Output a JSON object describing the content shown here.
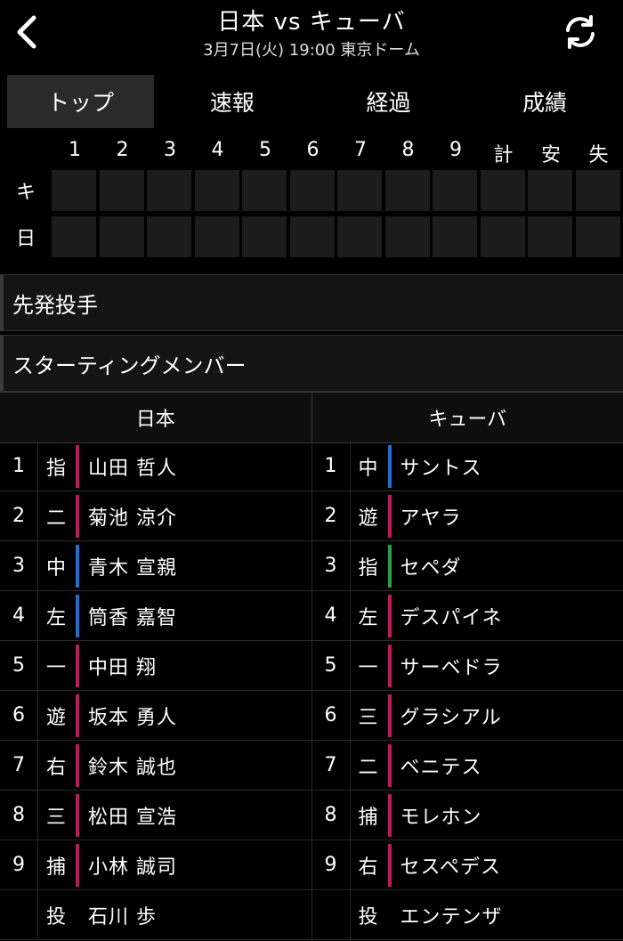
{
  "header": {
    "title": "日本 vs キューバ",
    "subtitle": "3月7日(火) 19:00 東京ドーム"
  },
  "tabs": [
    {
      "label": "トップ",
      "active": true
    },
    {
      "label": "速報",
      "active": false
    },
    {
      "label": "経過",
      "active": false
    },
    {
      "label": "成績",
      "active": false
    }
  ],
  "scoreboard": {
    "columns": [
      "1",
      "2",
      "3",
      "4",
      "5",
      "6",
      "7",
      "8",
      "9",
      "計",
      "安",
      "失"
    ],
    "teams": [
      "キ",
      "日"
    ]
  },
  "sections": {
    "starting_pitcher": "先発投手",
    "starting_members": "スターティングメンバー"
  },
  "lineup": {
    "home_label": "日本",
    "away_label": "キューバ",
    "colors": {
      "pink": "#c2185b",
      "blue": "#1e6fd9",
      "green": "#2e9e3e"
    },
    "japan": [
      {
        "order": "1",
        "pos": "指",
        "name": "山田 哲人",
        "bar": "pink"
      },
      {
        "order": "2",
        "pos": "二",
        "name": "菊池 涼介",
        "bar": "pink"
      },
      {
        "order": "3",
        "pos": "中",
        "name": "青木 宣親",
        "bar": "blue"
      },
      {
        "order": "4",
        "pos": "左",
        "name": "筒香 嘉智",
        "bar": "blue"
      },
      {
        "order": "5",
        "pos": "一",
        "name": "中田 翔",
        "bar": "pink"
      },
      {
        "order": "6",
        "pos": "遊",
        "name": "坂本 勇人",
        "bar": "pink"
      },
      {
        "order": "7",
        "pos": "右",
        "name": "鈴木 誠也",
        "bar": "pink"
      },
      {
        "order": "8",
        "pos": "三",
        "name": "松田 宣浩",
        "bar": "pink"
      },
      {
        "order": "9",
        "pos": "捕",
        "name": "小林 誠司",
        "bar": "pink"
      },
      {
        "order": "",
        "pos": "投",
        "name": "石川 歩",
        "bar": "none"
      }
    ],
    "cuba": [
      {
        "order": "1",
        "pos": "中",
        "name": "サントス",
        "bar": "blue"
      },
      {
        "order": "2",
        "pos": "遊",
        "name": "アヤラ",
        "bar": "pink"
      },
      {
        "order": "3",
        "pos": "指",
        "name": "セペダ",
        "bar": "green"
      },
      {
        "order": "4",
        "pos": "左",
        "name": "デスパイネ",
        "bar": "pink"
      },
      {
        "order": "5",
        "pos": "一",
        "name": "サーベドラ",
        "bar": "pink"
      },
      {
        "order": "6",
        "pos": "三",
        "name": "グラシアル",
        "bar": "pink"
      },
      {
        "order": "7",
        "pos": "二",
        "name": "ベニテス",
        "bar": "pink"
      },
      {
        "order": "8",
        "pos": "捕",
        "name": "モレホン",
        "bar": "pink"
      },
      {
        "order": "9",
        "pos": "右",
        "name": "セスペデス",
        "bar": "pink"
      },
      {
        "order": "",
        "pos": "投",
        "name": "エンテンザ",
        "bar": "none"
      }
    ]
  }
}
